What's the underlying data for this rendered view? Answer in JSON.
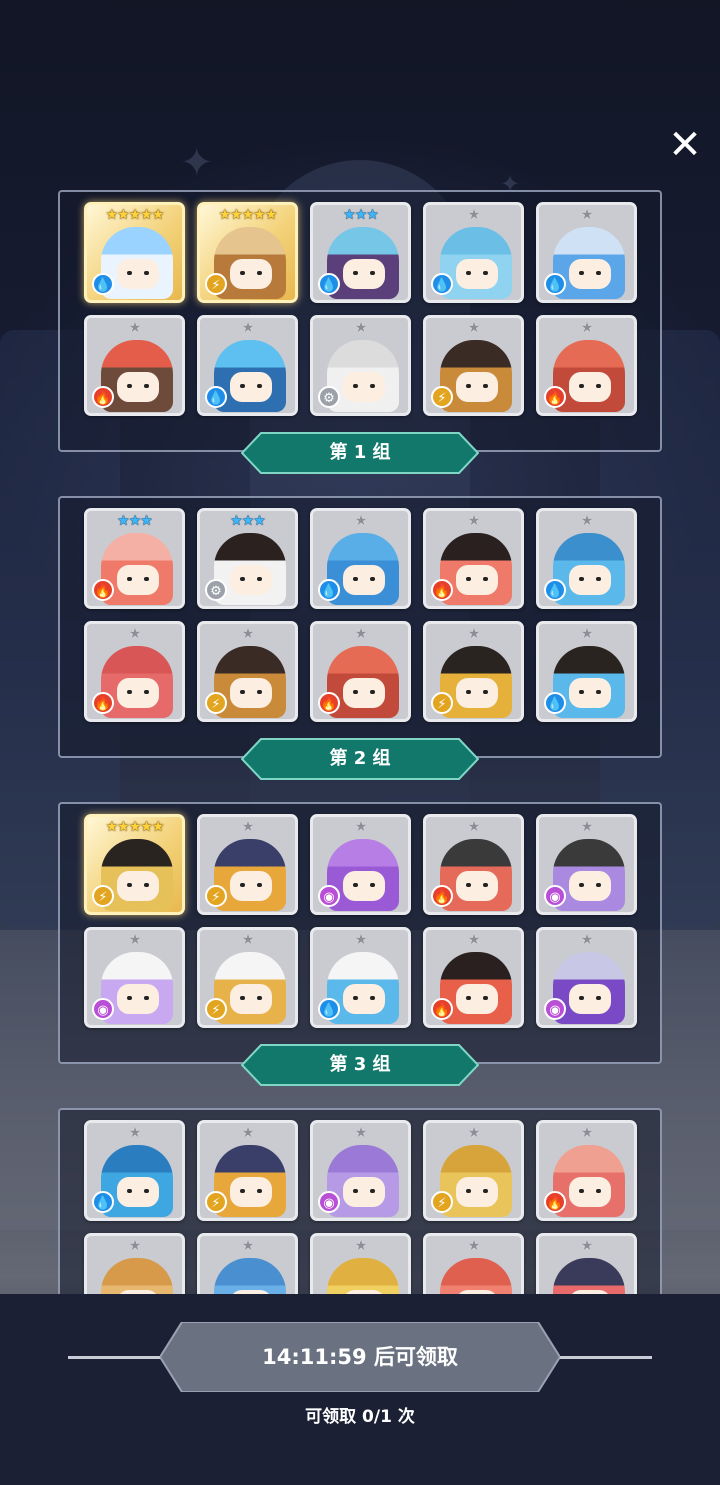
{
  "close_icon": "close-icon",
  "groups": [
    {
      "label": "第 1 组",
      "cards": [
        {
          "stars": "★★★★★",
          "tier": "gold",
          "element": "water",
          "body": "#e9f4ff",
          "hat": "#9ad3ff"
        },
        {
          "stars": "★★★★★",
          "tier": "gold",
          "element": "light",
          "body": "#b77a3a",
          "hat": "#e6c48d"
        },
        {
          "stars": "★★★",
          "tier": "blue",
          "element": "water",
          "body": "#5a3f7a",
          "hat": "#76c6e8"
        },
        {
          "stars": "★",
          "tier": "grey",
          "element": "water",
          "body": "#8fd3f0",
          "hat": "#6bbfe6"
        },
        {
          "stars": "★",
          "tier": "grey",
          "element": "water",
          "body": "#5aa6e8",
          "hat": "#cfe1f5"
        },
        {
          "stars": "★",
          "tier": "grey",
          "element": "fire",
          "body": "#6e4a3a",
          "hat": "#e45c4a"
        },
        {
          "stars": "★",
          "tier": "grey",
          "element": "water",
          "body": "#2d6fb0",
          "hat": "#5ec0f0"
        },
        {
          "stars": "★",
          "tier": "grey",
          "element": "wind",
          "body": "#f0f0f0",
          "hat": "#dcdcdc"
        },
        {
          "stars": "★",
          "tier": "grey",
          "element": "light",
          "body": "#c98a3a",
          "hat": "#3a2b25"
        },
        {
          "stars": "★",
          "tier": "grey",
          "element": "fire",
          "body": "#c24a3a",
          "hat": "#e66b55"
        }
      ]
    },
    {
      "label": "第 2 组",
      "cards": [
        {
          "stars": "★★★",
          "tier": "blue",
          "element": "fire",
          "body": "#f07a6a",
          "hat": "#f5b0a6"
        },
        {
          "stars": "★★★",
          "tier": "blue",
          "element": "wind",
          "body": "#f2f2f2",
          "hat": "#2b2220"
        },
        {
          "stars": "★",
          "tier": "grey",
          "element": "water",
          "body": "#3a8fd6",
          "hat": "#5aaee8"
        },
        {
          "stars": "★",
          "tier": "grey",
          "element": "fire",
          "body": "#f07a6a",
          "hat": "#2a2020"
        },
        {
          "stars": "★",
          "tier": "grey",
          "element": "water",
          "body": "#5ab8ea",
          "hat": "#3b8fcc"
        },
        {
          "stars": "★",
          "tier": "grey",
          "element": "fire",
          "body": "#e66a6a",
          "hat": "#d95656"
        },
        {
          "stars": "★",
          "tier": "grey",
          "element": "light",
          "body": "#c98a3a",
          "hat": "#3a2b25"
        },
        {
          "stars": "★",
          "tier": "grey",
          "element": "fire",
          "body": "#c24a3a",
          "hat": "#e66b55"
        },
        {
          "stars": "★",
          "tier": "grey",
          "element": "light",
          "body": "#e6b13a",
          "hat": "#2a2420"
        },
        {
          "stars": "★",
          "tier": "grey",
          "element": "water",
          "body": "#5ab8ea",
          "hat": "#2a2420"
        }
      ]
    },
    {
      "label": "第 3 组",
      "cards": [
        {
          "stars": "★★★★★",
          "tier": "gold",
          "element": "light",
          "body": "#e6c15a",
          "hat": "#2a2420"
        },
        {
          "stars": "★",
          "tier": "grey",
          "element": "light",
          "body": "#e8a73a",
          "hat": "#3a3f6a"
        },
        {
          "stars": "★",
          "tier": "grey",
          "element": "dark",
          "body": "#9a5ad6",
          "hat": "#b77fe6"
        },
        {
          "stars": "★",
          "tier": "grey",
          "element": "fire",
          "body": "#e66a5a",
          "hat": "#3a3a3a"
        },
        {
          "stars": "★",
          "tier": "grey",
          "element": "dark",
          "body": "#a98ae0",
          "hat": "#3a3a3a"
        },
        {
          "stars": "★",
          "tier": "grey",
          "element": "dark",
          "body": "#c8a8f0",
          "hat": "#f5f5f5"
        },
        {
          "stars": "★",
          "tier": "grey",
          "element": "light",
          "body": "#e8b24a",
          "hat": "#f5f5f5"
        },
        {
          "stars": "★",
          "tier": "grey",
          "element": "water",
          "body": "#5ab8ea",
          "hat": "#f5f5f5"
        },
        {
          "stars": "★",
          "tier": "grey",
          "element": "fire",
          "body": "#e8604a",
          "hat": "#2a2020"
        },
        {
          "stars": "★",
          "tier": "grey",
          "element": "dark",
          "body": "#7a4ac6",
          "hat": "#c8c8e6"
        }
      ]
    },
    {
      "label": "",
      "cards": [
        {
          "stars": "★",
          "tier": "grey",
          "element": "water",
          "body": "#3ea6e0",
          "hat": "#2a7ec0"
        },
        {
          "stars": "★",
          "tier": "grey",
          "element": "light",
          "body": "#e8a73a",
          "hat": "#3a3f6a"
        },
        {
          "stars": "★",
          "tier": "grey",
          "element": "dark",
          "body": "#b79ae6",
          "hat": "#9a7ad6"
        },
        {
          "stars": "★",
          "tier": "grey",
          "element": "light",
          "body": "#e8c45a",
          "hat": "#d6a43a"
        },
        {
          "stars": "★",
          "tier": "grey",
          "element": "fire",
          "body": "#e8706a",
          "hat": "#f0a090"
        },
        {
          "stars": "★",
          "tier": "grey",
          "element": "light",
          "body": "#e8b870",
          "hat": "#d69a4a"
        },
        {
          "stars": "★",
          "tier": "grey",
          "element": "water",
          "body": "#6ab0e8",
          "hat": "#4a90d0"
        },
        {
          "stars": "★",
          "tier": "grey",
          "element": "light",
          "body": "#f0d060",
          "hat": "#e0b040"
        },
        {
          "stars": "★",
          "tier": "grey",
          "element": "fire",
          "body": "#f08070",
          "hat": "#e06050"
        },
        {
          "stars": "★",
          "tier": "grey",
          "element": "fire",
          "body": "#e86a6a",
          "hat": "#3a3a5a"
        }
      ]
    }
  ],
  "claim": {
    "button_label": "14:11:59 后可领取",
    "count_text": "可领取 0/1 次"
  },
  "colors": {
    "label_bar": "#11786b",
    "label_bar_border": "#7fd6c4",
    "claim_button": "#6a7282"
  }
}
